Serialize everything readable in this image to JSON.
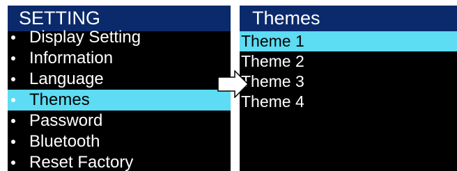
{
  "setting_screen": {
    "title": "SETTING",
    "items": [
      {
        "label": "Display Setting",
        "selected": false
      },
      {
        "label": "Information",
        "selected": false
      },
      {
        "label": "Language",
        "selected": false
      },
      {
        "label": "Themes",
        "selected": true
      },
      {
        "label": "Password",
        "selected": false
      },
      {
        "label": "Bluetooth",
        "selected": false
      },
      {
        "label": "Reset Factory",
        "selected": false
      }
    ]
  },
  "transition_icon": "right-arrow-icon",
  "themes_screen": {
    "title": "Themes",
    "items": [
      {
        "label": "Theme 1",
        "selected": true
      },
      {
        "label": "Theme 2",
        "selected": false
      },
      {
        "label": "Theme 3",
        "selected": false
      },
      {
        "label": "Theme 4",
        "selected": false
      }
    ]
  },
  "colors": {
    "title_bar": "#0b2a6c",
    "highlight": "#5ddcf3",
    "screen_bg": "#000000",
    "text": "#ffffff"
  }
}
